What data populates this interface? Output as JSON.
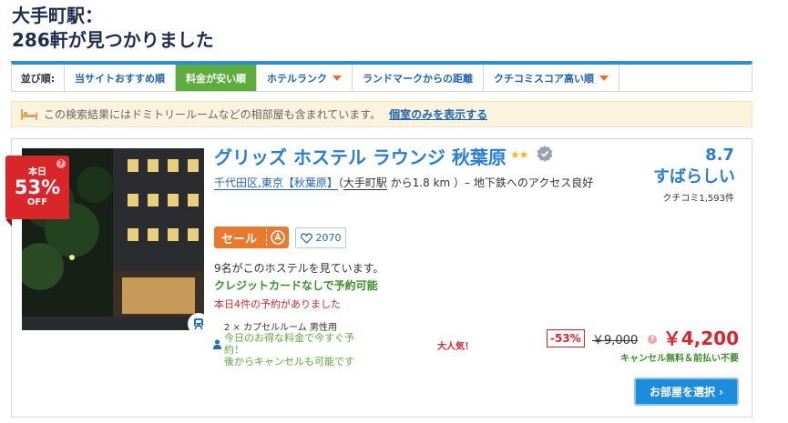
{
  "header": {
    "title_line1": "大手町駅：",
    "title_line2": "286軒が見つかりました"
  },
  "sort": {
    "label": "並び順:",
    "options": [
      {
        "label": "当サイトおすすめ順",
        "active": false,
        "dropdown": false
      },
      {
        "label": "料金が安い順",
        "active": true,
        "dropdown": false
      },
      {
        "label": "ホテルランク",
        "active": false,
        "dropdown": true
      },
      {
        "label": "ランドマークからの距離",
        "active": false,
        "dropdown": false
      },
      {
        "label": "クチコミスコア高い順",
        "active": false,
        "dropdown": true
      }
    ]
  },
  "notice": {
    "text": "この検索結果にはドミトリールームなどの相部屋も含まれています。",
    "link": "個室のみを表示する"
  },
  "hotel": {
    "discount_top": "本日",
    "discount_pct": "53%",
    "discount_off": "OFF",
    "name": "グリッズ ホステル ラウンジ 秋葉原",
    "stars": "★★",
    "location_link": "千代田区,東京【秋葉原】",
    "location_paren_open": "（",
    "station": "大手町駅",
    "distance": " から1.8 km ",
    "location_rest": "）– 地下鉄へのアクセス良好",
    "score": "8.7",
    "score_word": "すばらしい",
    "review_count": "クチコミ1,593件",
    "sale_label": "セール",
    "favorites": "2070",
    "viewers": "9名がこのホステルを見ています。",
    "no_credit_card": "クレジットカードなしで予約可能",
    "booked_today": "本日4件の予約がありました",
    "room_type": "2 × カプセルルーム 男性用",
    "deal_text": "今日のお得な料金で今すぐ予約！\n後からキャンセルも可能です",
    "popular": "大人気！",
    "discount_box": "-53%",
    "original_price": "￥9,000",
    "price": "￥4,200",
    "cancel_note": "キャンセル無料＆前払い不要",
    "choose_button": "お部屋を選択 ›"
  },
  "colors": {
    "accent_blue": "#2a7fd4",
    "active_green": "#5cad3c",
    "sale_orange": "#e8792f",
    "price_red": "#d9262a"
  },
  "icons": [
    "bed-icon",
    "verified-check-icon",
    "train-icon",
    "heart-icon",
    "person-icon",
    "sale-badge-icon",
    "question-icon"
  ]
}
